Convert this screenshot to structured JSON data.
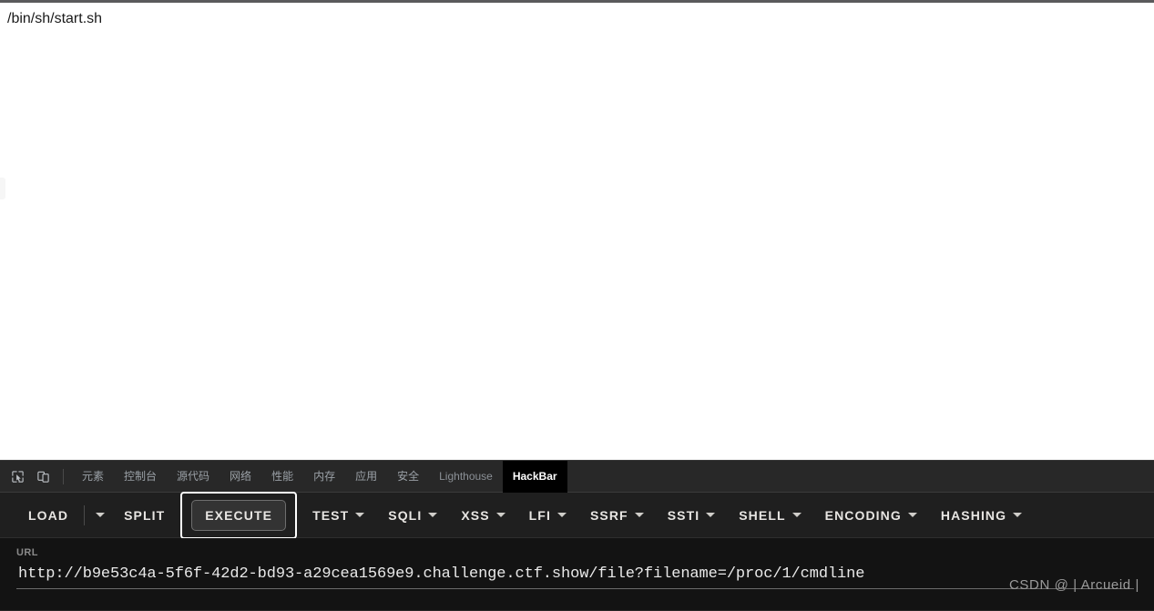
{
  "page": {
    "body_text": "/bin/sh/start.sh"
  },
  "devtools": {
    "inspect_icon": "inspect-element-icon",
    "device_icon": "device-toolbar-icon",
    "tabs": [
      {
        "label": "元素",
        "active": false
      },
      {
        "label": "控制台",
        "active": false
      },
      {
        "label": "源代码",
        "active": false
      },
      {
        "label": "网络",
        "active": false
      },
      {
        "label": "性能",
        "active": false
      },
      {
        "label": "内存",
        "active": false
      },
      {
        "label": "应用",
        "active": false
      },
      {
        "label": "安全",
        "active": false
      },
      {
        "label": "Lighthouse",
        "active": false
      },
      {
        "label": "HackBar",
        "active": true
      }
    ]
  },
  "hackbar": {
    "load_label": "LOAD",
    "load_caret_icon": "chevron-down-icon",
    "split_label": "SPLIT",
    "execute_label": "EXECUTE",
    "menus": [
      {
        "label": "TEST",
        "caret_icon": "chevron-down-icon"
      },
      {
        "label": "SQLI",
        "caret_icon": "chevron-down-icon"
      },
      {
        "label": "XSS",
        "caret_icon": "chevron-down-icon"
      },
      {
        "label": "LFI",
        "caret_icon": "chevron-down-icon"
      },
      {
        "label": "SSRF",
        "caret_icon": "chevron-down-icon"
      },
      {
        "label": "SSTI",
        "caret_icon": "chevron-down-icon"
      },
      {
        "label": "SHELL",
        "caret_icon": "chevron-down-icon"
      },
      {
        "label": "ENCODING",
        "caret_icon": "chevron-down-icon"
      },
      {
        "label": "HASHING",
        "caret_icon": "chevron-down-icon"
      }
    ],
    "url_label": "URL",
    "url_value": "http://b9e53c4a-5f6f-42d2-bd93-a29cea1569e9.challenge.ctf.show/file?filename=/proc/1/cmdline",
    "url_placeholder": "URL"
  },
  "watermark": {
    "text": "CSDN @ | Arcueid |"
  },
  "colors": {
    "devtools_bg": "#282828",
    "toolbar_bg": "#1f1f1f",
    "url_bg": "#131313",
    "active_tab_bg": "#000000",
    "focus_ring": "#ffffff",
    "page_bg": "#ffffff"
  }
}
